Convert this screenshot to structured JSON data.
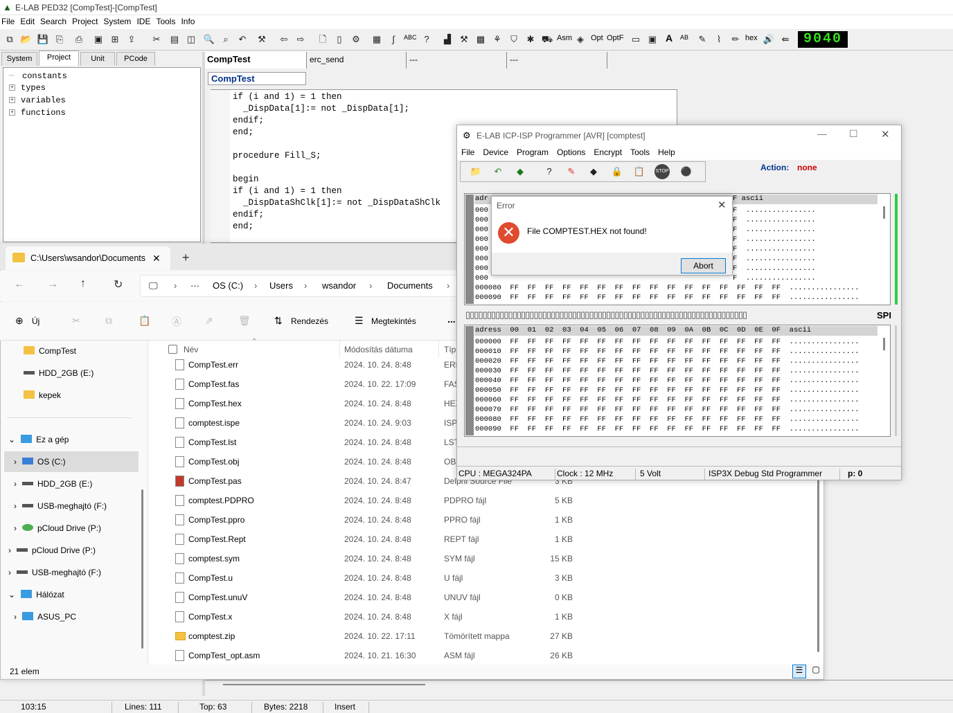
{
  "main": {
    "title": "E-LAB PED32 [CompTest]-[CompTest]",
    "menu": [
      "File",
      "Edit",
      "Search",
      "Project",
      "System",
      "IDE",
      "Tools",
      "Info"
    ],
    "toolbar_text": {
      "abc": "ABC",
      "asm": "Asm",
      "opt": "Opt",
      "optf": "OptF",
      "a": "A",
      "ab": "AB",
      "hex": "hex"
    },
    "lcd": "9040",
    "left_tabs": [
      "System",
      "Project",
      "Unit",
      "PCode"
    ],
    "tree": [
      "constants",
      "types",
      "variables",
      "functions"
    ],
    "editor_tabs": [
      "CompTest",
      "erc_send",
      "---",
      "---"
    ],
    "subtab": "CompTest",
    "code": [
      "if (i and 1) = 1 then",
      "  _DispData[1]:= not _DispData[1];",
      "endif;",
      "end;",
      "",
      "procedure Fill_S;",
      "",
      "begin",
      "if (i and 1) = 1 then",
      "  _DispDataShClk[1]:= not _DispDataShClk",
      "endif;",
      "end;"
    ],
    "status": {
      "pos": "103:15",
      "lines": "Lines: 111",
      "top": "Top: 63",
      "bytes": "Bytes: 2218",
      "mode": "Insert"
    }
  },
  "explorer": {
    "tab_title": "C:\\Users\\wsandor\\Documents",
    "breadcrumb": [
      "OS (C:)",
      "Users",
      "wsandor",
      "Documents"
    ],
    "cmd": {
      "new": "Új",
      "sort": "Rendezés",
      "view": "Megtekintés",
      "more": "..."
    },
    "nav": [
      "CompTest",
      "HDD_2GB (E:)",
      "kepek",
      "Ez a gép",
      "OS (C:)",
      "HDD_2GB (E:)",
      "USB-meghajtó (F:)",
      "pCloud Drive (P:)",
      "pCloud Drive (P:)",
      "USB-meghajtó (F:)",
      "Hálózat",
      "ASUS_PC"
    ],
    "columns": {
      "name": "Név",
      "date": "Módosítás dátuma",
      "type": "Típ"
    },
    "files": [
      {
        "name": "CompTest.err",
        "date": "2024. 10. 24. 8:48",
        "type": "ERR",
        "size": ""
      },
      {
        "name": "CompTest.fas",
        "date": "2024. 10. 22. 17:09",
        "type": "FAS",
        "size": ""
      },
      {
        "name": "CompTest.hex",
        "date": "2024. 10. 24. 8:48",
        "type": "HEX",
        "size": ""
      },
      {
        "name": "comptest.ispe",
        "date": "2024. 10. 24. 9:03",
        "type": "ISPE",
        "size": ""
      },
      {
        "name": "CompTest.lst",
        "date": "2024. 10. 24. 8:48",
        "type": "LST",
        "size": ""
      },
      {
        "name": "CompTest.obj",
        "date": "2024. 10. 24. 8:48",
        "type": "OBJ",
        "size": ""
      },
      {
        "name": "CompTest.pas",
        "date": "2024. 10. 24. 8:47",
        "type": "Delphi Source File",
        "size": "3 KB"
      },
      {
        "name": "comptest.PDPRO",
        "date": "2024. 10. 24. 8:48",
        "type": "PDPRO fájl",
        "size": "5 KB"
      },
      {
        "name": "CompTest.ppro",
        "date": "2024. 10. 24. 8:48",
        "type": "PPRO fájl",
        "size": "1 KB"
      },
      {
        "name": "CompTest.Rept",
        "date": "2024. 10. 24. 8:48",
        "type": "REPT fájl",
        "size": "1 KB"
      },
      {
        "name": "comptest.sym",
        "date": "2024. 10. 24. 8:48",
        "type": "SYM fájl",
        "size": "15 KB"
      },
      {
        "name": "CompTest.u",
        "date": "2024. 10. 24. 8:48",
        "type": "U fájl",
        "size": "3 KB"
      },
      {
        "name": "CompTest.unuV",
        "date": "2024. 10. 24. 8:48",
        "type": "UNUV fájl",
        "size": "0 KB"
      },
      {
        "name": "CompTest.x",
        "date": "2024. 10. 24. 8:48",
        "type": "X fájl",
        "size": "1 KB"
      },
      {
        "name": "comptest.zip",
        "date": "2024. 10. 22. 17:11",
        "type": "Tömörített mappa",
        "size": "27 KB"
      },
      {
        "name": "CompTest_opt.asm",
        "date": "2024. 10. 21. 16:30",
        "type": "ASM fájl",
        "size": "26 KB"
      }
    ],
    "count": "21 elem"
  },
  "programmer": {
    "title": "E-LAB ICP-ISP Programmer [AVR]  [comptest]",
    "menu": [
      "File",
      "Device",
      "Program",
      "Options",
      "Encrypt",
      "Tools",
      "Help"
    ],
    "action_label": "Action:",
    "action_value": "none",
    "stop": "STOP",
    "hex1_header": "adr",
    "hex1_ascii": "F ascii",
    "hex1_rows": [
      "000",
      "000",
      "000",
      "000",
      "000",
      "000",
      "000",
      "000"
    ],
    "hex1_tail": "F  ................",
    "hex1_full": [
      "000080  FF  FF  FF  FF  FF  FF  FF  FF  FF  FF  FF  FF  FF  FF  FF  FF  ................",
      "000090  FF  FF  FF  FF  FF  FF  FF  FF  FF  FF  FF  FF  FF  FF  FF  FF  ................"
    ],
    "spi": "SPI",
    "hex2_header": "adress  00  01  02  03  04  05  06  07  08  09  0A  0B  0C  0D  0E  0F  ascii",
    "hex2_rows": [
      "000000  FF  FF  FF  FF  FF  FF  FF  FF  FF  FF  FF  FF  FF  FF  FF  FF  ................",
      "000010  FF  FF  FF  FF  FF  FF  FF  FF  FF  FF  FF  FF  FF  FF  FF  FF  ................",
      "000020  FF  FF  FF  FF  FF  FF  FF  FF  FF  FF  FF  FF  FF  FF  FF  FF  ................",
      "000030  FF  FF  FF  FF  FF  FF  FF  FF  FF  FF  FF  FF  FF  FF  FF  FF  ................",
      "000040  FF  FF  FF  FF  FF  FF  FF  FF  FF  FF  FF  FF  FF  FF  FF  FF  ................",
      "000050  FF  FF  FF  FF  FF  FF  FF  FF  FF  FF  FF  FF  FF  FF  FF  FF  ................",
      "000060  FF  FF  FF  FF  FF  FF  FF  FF  FF  FF  FF  FF  FF  FF  FF  FF  ................",
      "000070  FF  FF  FF  FF  FF  FF  FF  FF  FF  FF  FF  FF  FF  FF  FF  FF  ................",
      "000080  FF  FF  FF  FF  FF  FF  FF  FF  FF  FF  FF  FF  FF  FF  FF  FF  ................",
      "000090  FF  FF  FF  FF  FF  FF  FF  FF  FF  FF  FF  FF  FF  FF  FF  FF  ................"
    ],
    "status": {
      "cpu": "CPU : MEGA324PA",
      "clock": "Clock : 12 MHz",
      "volt": "5 Volt",
      "prog": "ISP3X Debug Std Programmer",
      "p": "p: 0"
    }
  },
  "error": {
    "title": "Error",
    "message": "File COMPTEST.HEX not found!",
    "abort": "Abort"
  },
  "colors": {
    "action_none": "#cc0000",
    "action_label": "#00318a",
    "lcd": "#36e01e",
    "error_icon": "#e04a2f",
    "accent": "#0078d4"
  }
}
